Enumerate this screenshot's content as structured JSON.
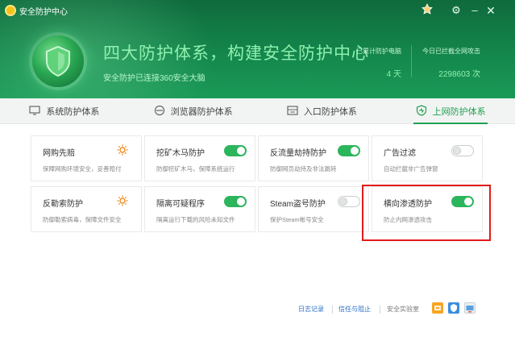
{
  "app": {
    "title": "安全防护中心"
  },
  "hero": {
    "title": "四大防护体系，构建安全防护中心",
    "subtitle": "安全防护已连接360安全大脑"
  },
  "stats": [
    {
      "label": "已累计防护电脑",
      "value": "4 天"
    },
    {
      "label": "今日已拦截全网攻击",
      "value": "2298603 次"
    }
  ],
  "tabs": [
    {
      "label": "系统防护体系",
      "icon": "monitor-icon",
      "active": false
    },
    {
      "label": "浏览器防护体系",
      "icon": "browser-icon",
      "active": false
    },
    {
      "label": "入口防护体系",
      "icon": "entry-icon",
      "active": false
    },
    {
      "label": "上网防护体系",
      "icon": "shield-heart-icon",
      "active": true
    }
  ],
  "cards": [
    {
      "title": "网购先赔",
      "desc": "保障网购环境安全，妥善赔付",
      "control": "sun-icon"
    },
    {
      "title": "挖矿木马防护",
      "desc": "防御挖矿木马，保障系统运行",
      "control": "on"
    },
    {
      "title": "反流量劫持防护",
      "desc": "防御网页劫持及非法跳转",
      "control": "on"
    },
    {
      "title": "广告过滤",
      "desc": "自动拦截非广告弹窗",
      "control": "off"
    },
    {
      "title": "反勒索防护",
      "desc": "防御勒索病毒，保障文件安全",
      "control": "sun-icon"
    },
    {
      "title": "隔离可疑程序",
      "desc": "隔离运行下载的风险未知文件",
      "control": "on"
    },
    {
      "title": "Steam盗号防护",
      "desc": "保护Steam帐号安全",
      "control": "off"
    },
    {
      "title": "横向渗透防护",
      "desc": "防止内网渗透攻击",
      "control": "on"
    }
  ],
  "footer": {
    "log": "日志记录",
    "trust": "信任与阻止",
    "lab": "安全实验室"
  },
  "colors": {
    "accent": "#20a052",
    "header": "#14874c",
    "highlight": "#e21b1b"
  }
}
